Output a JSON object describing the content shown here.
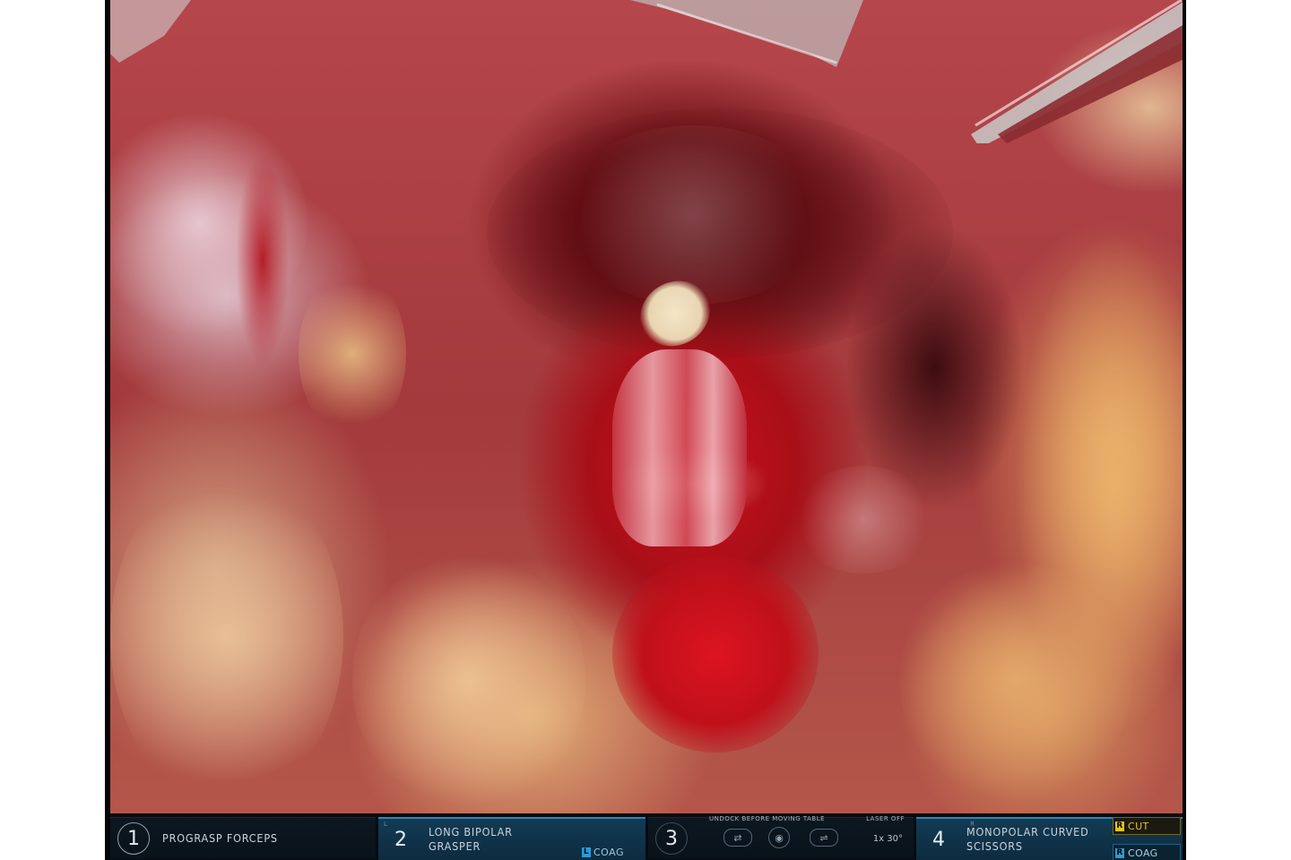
{
  "scene": {
    "description_icon": "surgical-video-icon"
  },
  "colors": {
    "hud_background": "#070b10",
    "active_slot": "#133b54",
    "cut_yellow": "#e8c21a",
    "coag_blue": "#2b9bd6",
    "tissue_red": "#c8101c"
  },
  "hud": {
    "arms": [
      {
        "number": "1",
        "name": "PROGRASP FORCEPS",
        "active": false
      },
      {
        "number": "2",
        "name": "LONG BIPOLAR\nGRASPER",
        "active": true,
        "side": "L",
        "mode_letter": "L",
        "mode": "COAG"
      },
      {
        "number": "3",
        "camera_status": "UNDOCK BEFORE MOVING TABLE",
        "laser": "LASER OFF",
        "zoom": "1x  30°"
      },
      {
        "number": "4",
        "name": "MONOPOLAR CURVED\nSCISSORS",
        "active": true,
        "side": "R",
        "cut_letter": "R",
        "cut": "CUT",
        "coag_letter": "R",
        "coag": "COAG"
      }
    ]
  }
}
